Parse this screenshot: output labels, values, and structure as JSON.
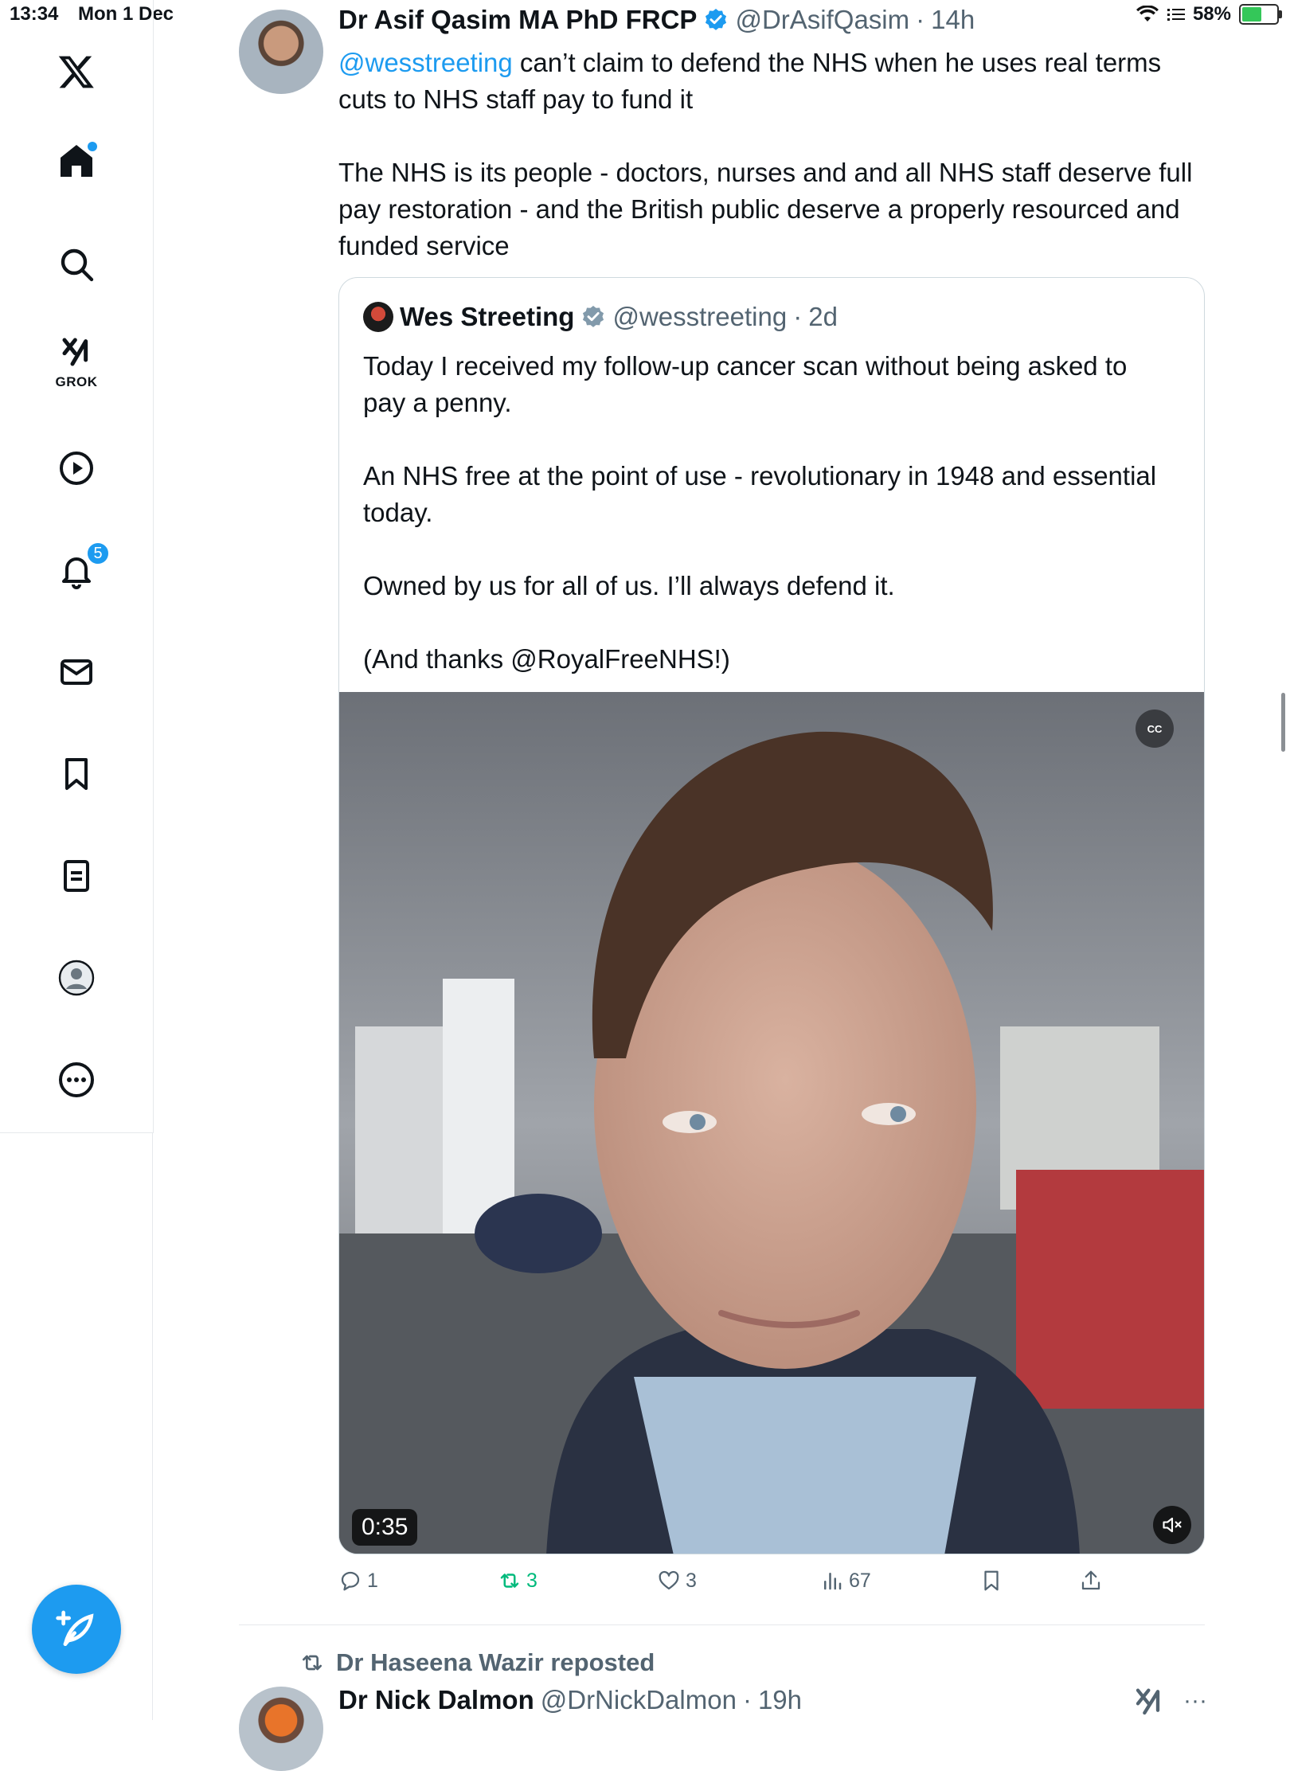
{
  "status_bar": {
    "time": "13:34",
    "date": "Mon 1 Dec",
    "battery": "58%",
    "battery_level": 0.58
  },
  "sidebar": {
    "items": [
      {
        "name": "x-logo-icon"
      },
      {
        "name": "home-icon"
      },
      {
        "name": "search-icon"
      },
      {
        "name": "grok-icon",
        "label": "GROK"
      },
      {
        "name": "video-play-icon"
      },
      {
        "name": "notifications-icon",
        "badge": "5"
      },
      {
        "name": "messages-icon"
      },
      {
        "name": "bookmarks-icon"
      },
      {
        "name": "lists-icon"
      },
      {
        "name": "profile-icon"
      },
      {
        "name": "more-icon"
      }
    ],
    "compose_icon": "feather-plus-icon"
  },
  "tweet": {
    "author_name": "Dr Asif Qasim MA PhD FRCP",
    "handle": "@DrAsifQasim",
    "time": "14h",
    "mention": "@wesstreeting",
    "text_part1": " can’t claim to defend the NHS when he uses real terms cuts to NHS staff pay to fund it",
    "text_part2": "The NHS is its people - doctors, nurses and and all NHS staff deserve full pay restoration - and the British public deserve a properly resourced and funded service",
    "quote": {
      "author_name": "Wes Streeting",
      "handle": "@wesstreeting",
      "time": "2d",
      "paragraphs": [
        "Today I received my follow-up cancer scan without being asked to pay a penny.",
        "An NHS free at the point of use - revolutionary in 1948 and essential today.",
        "Owned by us for all of us. I’ll always defend it.",
        "(And thanks @RoyalFreeNHS!)"
      ],
      "video": {
        "duration": "0:35",
        "cc_label": "CC"
      }
    },
    "actions": {
      "replies": "1",
      "retweets": "3",
      "likes": "3",
      "views": "67"
    }
  },
  "next": {
    "reposted_by": "Dr Haseena Wazir reposted",
    "author_name": "Dr Nick Dalmon",
    "handle": "@DrNickDalmon",
    "time": "19h",
    "more": "···"
  },
  "colors": {
    "accent": "#1d9bf0",
    "retweet": "#00ba7c",
    "muted": "#536471"
  }
}
